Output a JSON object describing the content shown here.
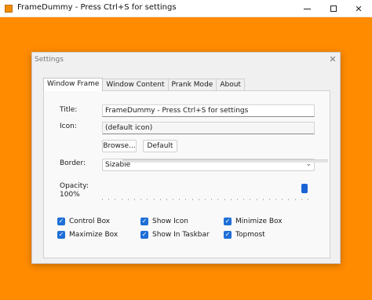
{
  "outer_window": {
    "title": "FrameDummy - Press Ctrl+S for settings",
    "background_color": "#fe8b00"
  },
  "dialog": {
    "title": "Settings",
    "tabs": [
      {
        "label": "Window Frame",
        "active": true
      },
      {
        "label": "Window Content",
        "active": false
      },
      {
        "label": "Prank Mode",
        "active": false
      },
      {
        "label": "About",
        "active": false
      }
    ],
    "form": {
      "title_label": "Title:",
      "title_value": "FrameDummy - Press Ctrl+S for settings",
      "icon_label": "Icon:",
      "icon_value": "(default icon)",
      "browse_label": "Browse...",
      "default_label": "Default",
      "border_label": "Border:",
      "border_value": "Sizable",
      "opacity_label": "Opacity:",
      "opacity_value": "100%",
      "opacity_level": 1.0
    },
    "checkboxes": [
      {
        "label": "Control Box",
        "checked": true
      },
      {
        "label": "Show Icon",
        "checked": true
      },
      {
        "label": "Minimize Box",
        "checked": true
      },
      {
        "label": "Maximize Box",
        "checked": true
      },
      {
        "label": "Show In Taskbar",
        "checked": true
      },
      {
        "label": "Topmost",
        "checked": true
      }
    ]
  },
  "colors": {
    "accent": "#1f6fd6",
    "orange": "#fe8b00"
  }
}
